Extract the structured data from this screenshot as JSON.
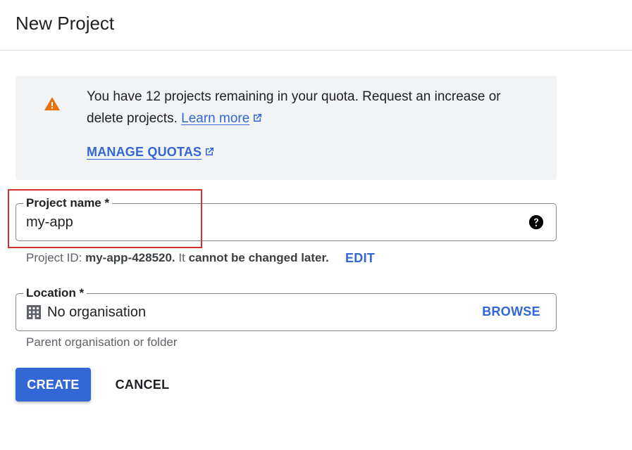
{
  "page": {
    "title": "New Project"
  },
  "quota": {
    "message": "You have 12 projects remaining in your quota. Request an increase or delete projects.",
    "learn_more": "Learn more",
    "manage_quotas": "MANAGE QUOTAS",
    "icon": "warning-icon",
    "icon_color": "#e8710a"
  },
  "project_name": {
    "label": "Project name *",
    "value": "my-app",
    "help_icon": "help-icon"
  },
  "project_id": {
    "prefix": "Project ID: ",
    "id": "my-app-428520.",
    "middle": " It ",
    "bold_text": "cannot be changed later.",
    "edit_label": "EDIT"
  },
  "location": {
    "label": "Location *",
    "value": "No organisation",
    "browse_label": "BROWSE",
    "hint": "Parent organisation or folder",
    "icon": "building-icon"
  },
  "actions": {
    "create_label": "CREATE",
    "cancel_label": "CANCEL"
  },
  "colors": {
    "accent": "#3367d6",
    "highlight": "#d32f2f"
  }
}
